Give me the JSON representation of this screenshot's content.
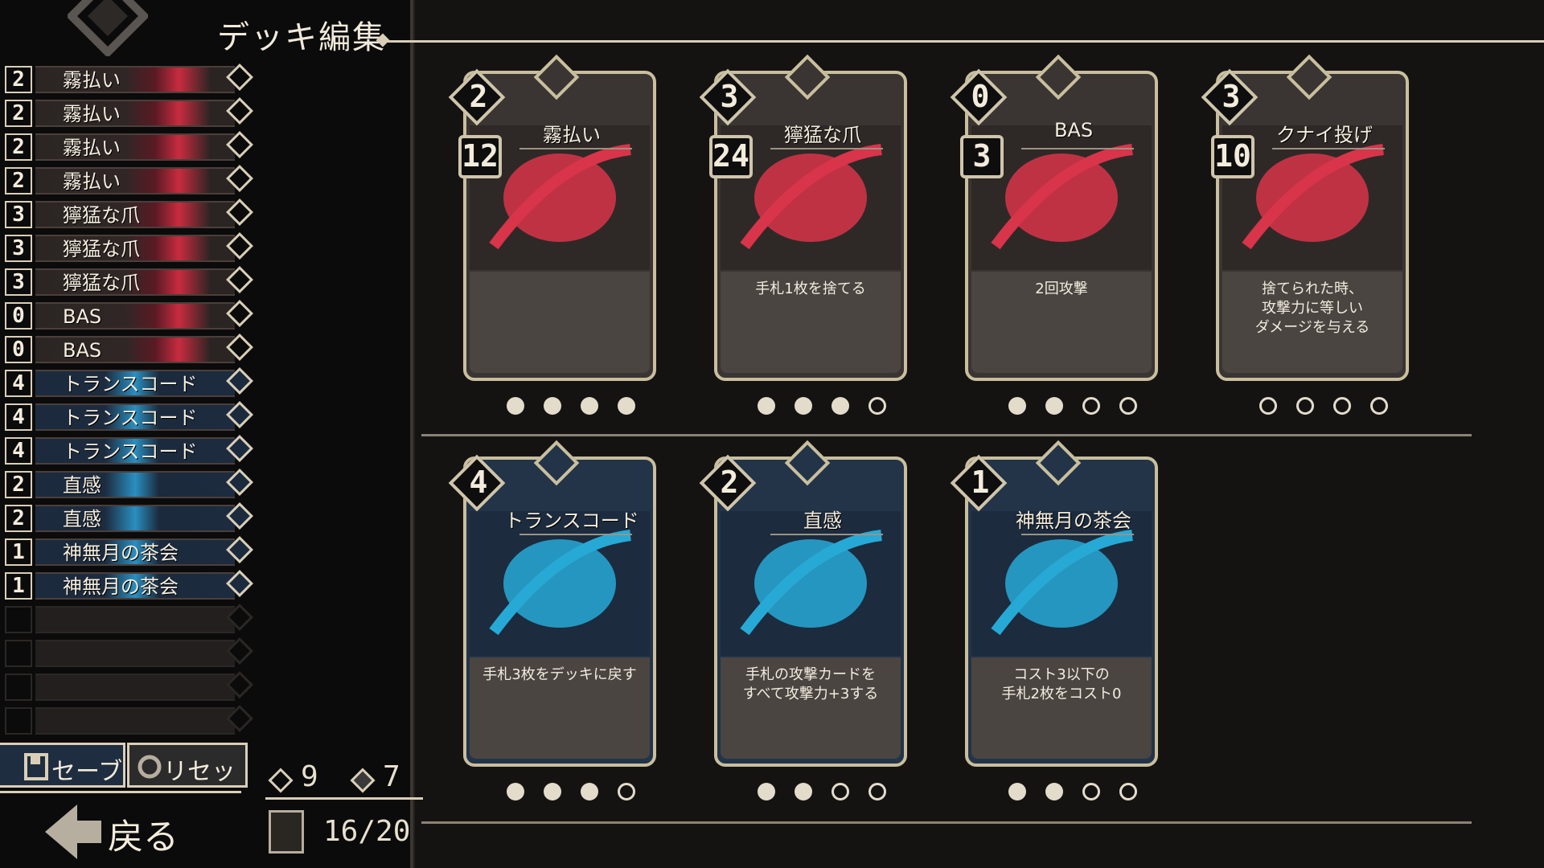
{
  "screen_title": "デッキ編集",
  "deck_list": [
    {
      "cost": "2",
      "name": "霧払い",
      "color": "red"
    },
    {
      "cost": "2",
      "name": "霧払い",
      "color": "red"
    },
    {
      "cost": "2",
      "name": "霧払い",
      "color": "red"
    },
    {
      "cost": "2",
      "name": "霧払い",
      "color": "red"
    },
    {
      "cost": "3",
      "name": "獰猛な爪",
      "color": "red"
    },
    {
      "cost": "3",
      "name": "獰猛な爪",
      "color": "red"
    },
    {
      "cost": "3",
      "name": "獰猛な爪",
      "color": "red"
    },
    {
      "cost": "0",
      "name": "BAS",
      "color": "red"
    },
    {
      "cost": "0",
      "name": "BAS",
      "color": "red"
    },
    {
      "cost": "4",
      "name": "トランスコード",
      "color": "blue"
    },
    {
      "cost": "4",
      "name": "トランスコード",
      "color": "blue"
    },
    {
      "cost": "4",
      "name": "トランスコード",
      "color": "blue"
    },
    {
      "cost": "2",
      "name": "直感",
      "color": "blue"
    },
    {
      "cost": "2",
      "name": "直感",
      "color": "blue"
    },
    {
      "cost": "1",
      "name": "神無月の茶会",
      "color": "blue"
    },
    {
      "cost": "1",
      "name": "神無月の茶会",
      "color": "blue"
    }
  ],
  "empty_slots": 4,
  "buttons": {
    "save": "セーブ",
    "reset": "リセット",
    "back": "戻る"
  },
  "stats": {
    "attack_cards": "9",
    "skill_cards": "7",
    "deck_count": "16/20"
  },
  "cards": [
    {
      "name": "霧払い",
      "cost": "2",
      "attack": "12",
      "desc": "",
      "theme": "red",
      "copies": 4,
      "max": 4,
      "icon": "slash-art"
    },
    {
      "name": "獰猛な爪",
      "cost": "3",
      "attack": "24",
      "desc": "手札1枚を捨てる",
      "theme": "red",
      "copies": 3,
      "max": 4,
      "icon": "claw-art"
    },
    {
      "name": "BAS",
      "cost": "0",
      "attack": "3",
      "desc": "2回攻撃",
      "theme": "red",
      "copies": 2,
      "max": 4,
      "icon": "blade-art"
    },
    {
      "name": "クナイ投げ",
      "cost": "3",
      "attack": "10",
      "desc": "捨てられた時、\n攻撃力に等しい\nダメージを与える",
      "theme": "red",
      "copies": 0,
      "max": 4,
      "icon": "kunai-art"
    },
    {
      "name": "トランスコード",
      "cost": "4",
      "attack": "",
      "desc": "手札3枚をデッキに戻す",
      "theme": "blue",
      "copies": 3,
      "max": 4,
      "icon": "hourglass-art"
    },
    {
      "name": "直感",
      "cost": "2",
      "attack": "",
      "desc": "手札の攻撃カードを\nすべて攻撃力+3する",
      "theme": "blue",
      "copies": 2,
      "max": 4,
      "icon": "figure-art"
    },
    {
      "name": "神無月の茶会",
      "cost": "1",
      "attack": "",
      "desc": "コスト3以下の\n手札2枚をコスト0",
      "theme": "blue",
      "copies": 2,
      "max": 4,
      "icon": "teacup-art"
    }
  ]
}
